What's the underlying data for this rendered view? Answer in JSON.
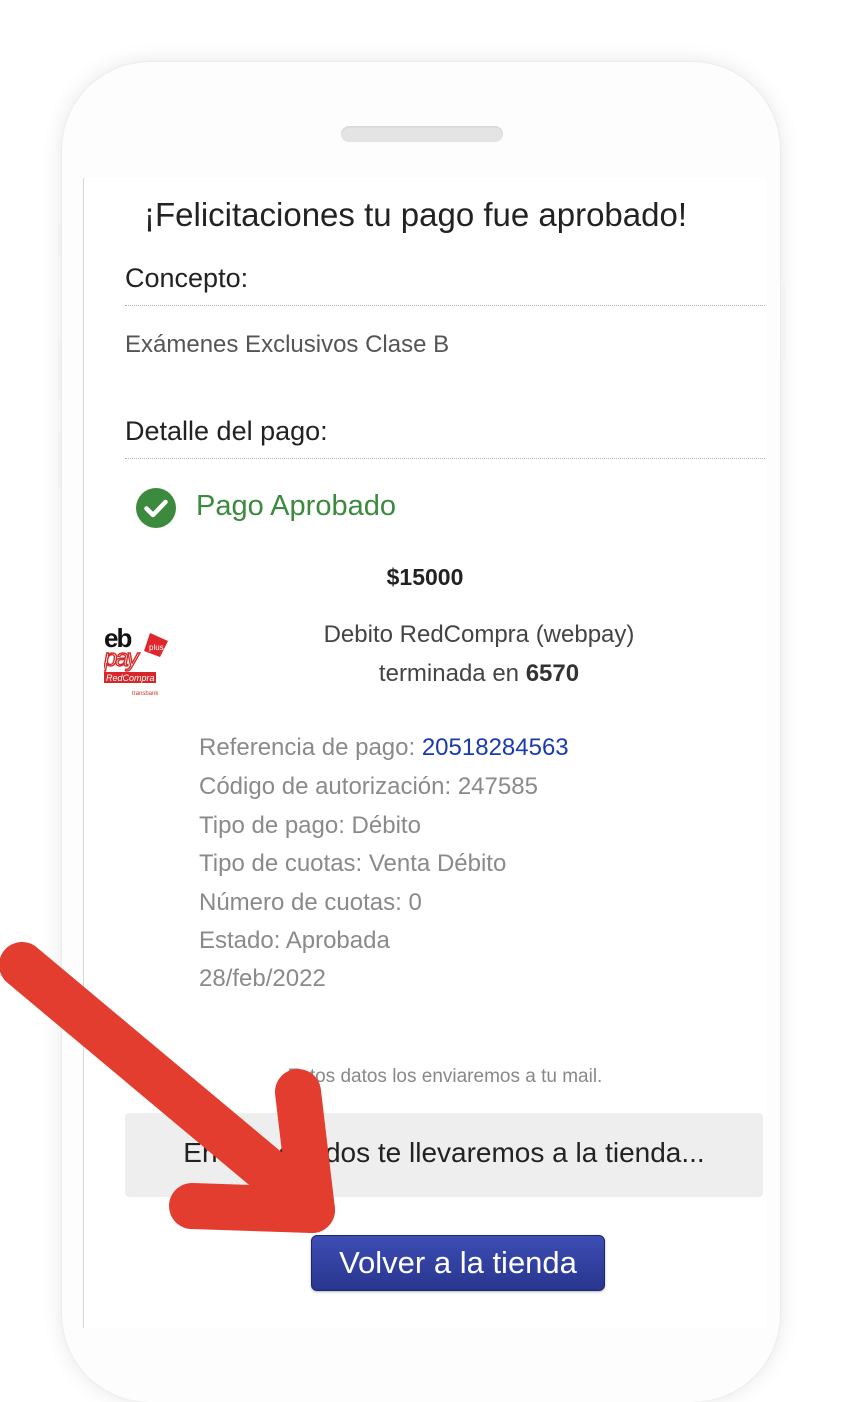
{
  "page": {
    "title": "¡Felicitaciones tu pago fue aprobado!",
    "concept_label": "Concepto:",
    "concept_value": "Exámenes Exclusivos Clase B",
    "detail_label": "Detalle del pago:",
    "status": {
      "text": "Pago Aprobado",
      "icon": "check-circle-icon",
      "color": "#3b8a3e"
    },
    "amount": "$15000",
    "card": {
      "logo": "webpay-plus-redcompra-logo",
      "method": "Debito RedCompra (webpay)",
      "ending_prefix": "terminada en",
      "ending_digits": "6570"
    },
    "details": {
      "reference_label": "Referencia de pago:",
      "reference_value": "20518284563",
      "authorization": "Código de autorización: 247585",
      "payment_type": "Tipo de pago: Débito",
      "installment_type": "Tipo de cuotas: Venta Débito",
      "installment_count": "Número de cuotas: 0",
      "state": "Estado: Aprobada",
      "date": "28/feb/2022"
    },
    "mail_note": "Estos datos los enviaremos a tu mail.",
    "redirect_text": "En 4 segundos te llevaremos a la tienda...",
    "back_button_label": "Volver a la tienda"
  },
  "colors": {
    "accent_button": "#28368f",
    "success": "#3b8a3e",
    "link": "#1a3bb0",
    "annotation_arrow": "#e33d2f"
  }
}
